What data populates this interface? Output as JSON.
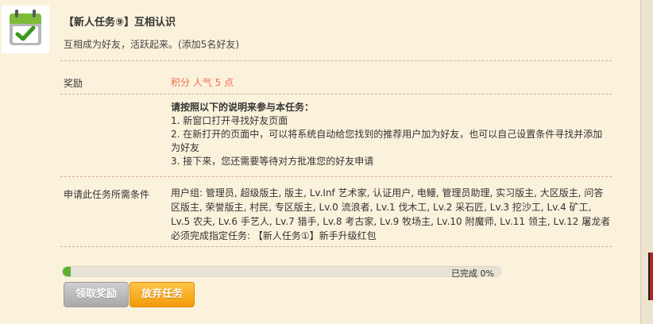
{
  "task": {
    "title": "【新人任务⑨】互相认识",
    "description": "互相成为好友，活跃起来。(添加5名好友)"
  },
  "reward": {
    "label": "奖励",
    "value": "积分 人气 5 点"
  },
  "instructions": {
    "heading": "请按照以下的说明来参与本任务：",
    "steps": [
      "1. 新窗口打开寻找好友页面",
      "2. 在新打开的页面中，可以将系统自动给您找到的推荐用户加为好友，也可以自己设置条件寻找并添加为好友",
      "3. 接下来，您还需要等待对方批准您的好友申请"
    ]
  },
  "conditions": {
    "label": "申请此任务所需条件",
    "user_groups": "用户组: 管理员, 超级版主, 版主, Lv.Inf 艺术家, 认证用户, 电鳗, 管理员助理, 实习版主, 大区版主, 问答区版主, 荣誉版主, 村民, 专区版主, Lv.0 流浪者, Lv.1 伐木工, Lv.2 采石匠, Lv.3 挖沙工, Lv.4 矿工, Lv.5 农夫, Lv.6 手艺人, Lv.7 猎手, Lv.8 考古家, Lv.9 牧场主, Lv.10 附魔师, Lv.11 领主, Lv.12 屠龙者",
    "prerequisite": "必须完成指定任务: 【新人任务①】新手升级红包"
  },
  "progress": {
    "percent": 0,
    "label": "已完成 0%"
  },
  "buttons": {
    "claim": "领取奖励",
    "abandon": "放弃任务"
  },
  "colors": {
    "reward_text": "#f26c4f",
    "progress_fill": "#5bb22e",
    "abandon_button": "#f29a08",
    "claim_button": "#b8b8b8"
  },
  "icons": {
    "task": "checkmark-calendar-icon"
  }
}
